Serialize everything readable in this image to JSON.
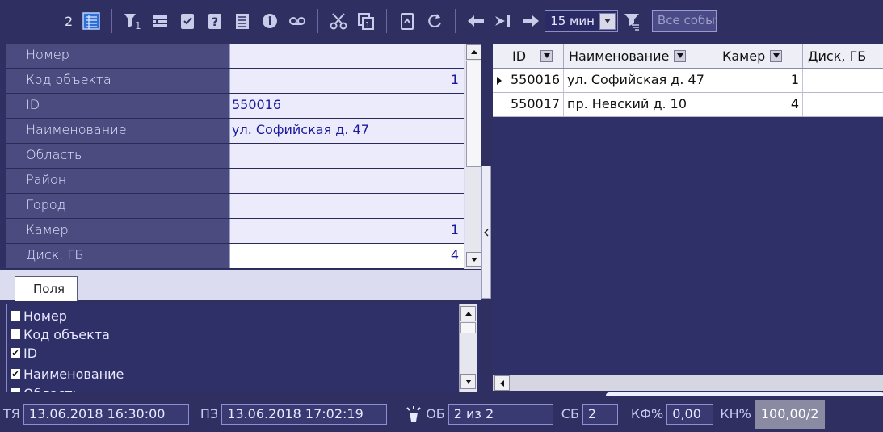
{
  "toolbar": {
    "count": "2",
    "interval": "15 мин",
    "search_placeholder": "Все события"
  },
  "properties": {
    "rows": [
      {
        "name": "Номер",
        "value": ""
      },
      {
        "name": "Код объекта",
        "value": "1"
      },
      {
        "name": "ID",
        "value": "550016"
      },
      {
        "name": "Наименование",
        "value": "ул. Софийская д. 47"
      },
      {
        "name": "Область",
        "value": ""
      },
      {
        "name": "Район",
        "value": ""
      },
      {
        "name": "Город",
        "value": ""
      },
      {
        "name": "Камер",
        "value": "1"
      },
      {
        "name": "Диск, ГБ",
        "value": "4"
      }
    ]
  },
  "tabs": {
    "fields_label": "Поля"
  },
  "field_list": {
    "items": [
      {
        "label": "Номер",
        "checked": false
      },
      {
        "label": "Код объекта",
        "checked": false
      },
      {
        "label": "ID",
        "checked": true
      },
      {
        "label": "Наименование",
        "checked": true
      },
      {
        "label": "Область",
        "checked": false
      }
    ]
  },
  "objects": {
    "columns": [
      "ID",
      "Наименование",
      "Камер",
      "Диск, ГБ"
    ],
    "rows": [
      {
        "id": "550016",
        "name": "ул. Софийская д. 47",
        "cameras": "1",
        "disk": ""
      },
      {
        "id": "550017",
        "name": "пр. Невский д. 10",
        "cameras": "4",
        "disk": ""
      }
    ]
  },
  "status": {
    "tya_label": "ТЯ",
    "tya_value": "13.06.2018 16:30:00",
    "pz_label": "ПЗ",
    "pz_value": "13.06.2018 17:02:19",
    "ob_label": "ОБ",
    "ob_value": "2 из 2",
    "sb_label": "СБ",
    "sb_value": "2",
    "kf_label": "КФ%",
    "kf_value": "0,00",
    "kn_label": "КН%",
    "kn_value": "100,00/2"
  }
}
